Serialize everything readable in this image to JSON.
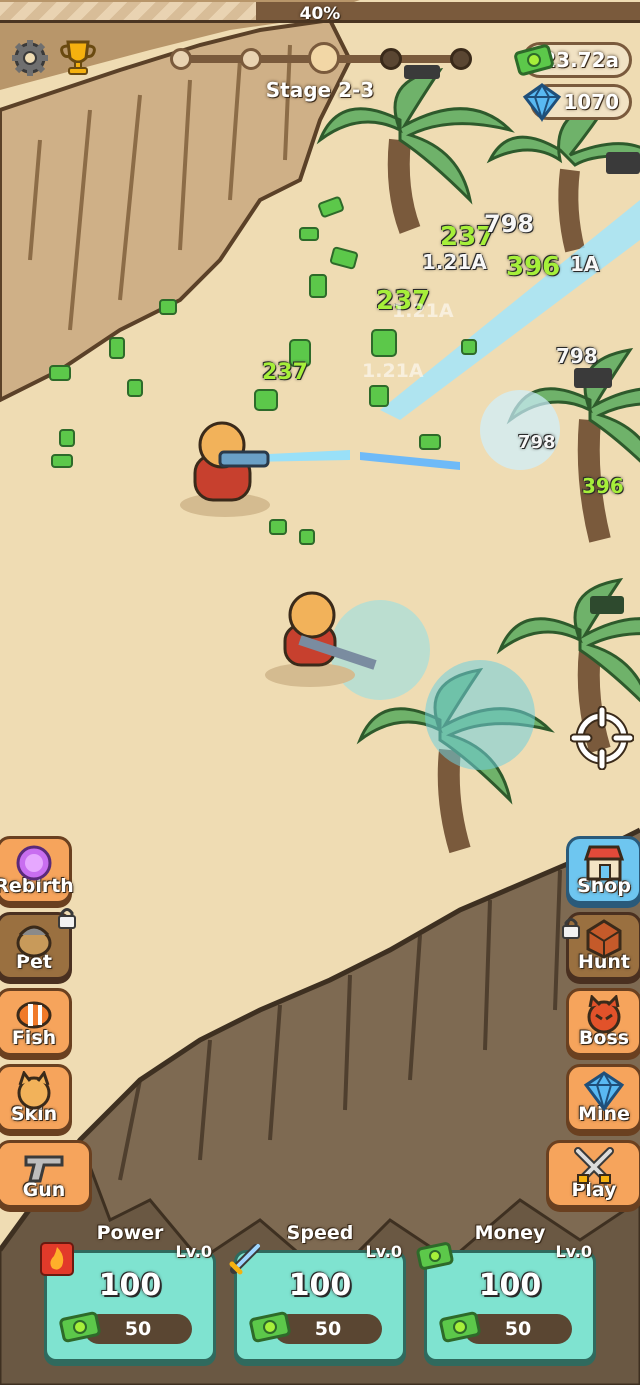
{
  "progress": {
    "percent": 0.4,
    "label": "40%"
  },
  "header": {
    "settings_icon": "gear-icon",
    "trophy_icon": "trophy-icon",
    "stage_label": "Stage 2-3",
    "stage_progress": {
      "completed_steps": 2,
      "current_step": 3,
      "total_steps": 5
    }
  },
  "currency": {
    "money": "23.72a",
    "gems": "1070"
  },
  "left_menu": [
    {
      "label": "Rebirth",
      "icon": "rebirth-orb-icon",
      "locked": false
    },
    {
      "label": "Pet",
      "icon": "pet-icon",
      "locked": true
    },
    {
      "label": "Fish",
      "icon": "clownfish-icon",
      "locked": false
    },
    {
      "label": "Skin",
      "icon": "cat-skin-icon",
      "locked": false
    },
    {
      "label": "Gun",
      "icon": "pistol-icon",
      "locked": false
    }
  ],
  "right_menu": [
    {
      "label": "Shop",
      "icon": "shop-icon",
      "locked": false
    },
    {
      "label": "Hunt",
      "icon": "hunt-crate-icon",
      "locked": true
    },
    {
      "label": "Boss",
      "icon": "boss-icon",
      "locked": false
    },
    {
      "label": "Mine",
      "icon": "gem-icon",
      "locked": false
    },
    {
      "label": "Play",
      "icon": "crossed-swords-icon",
      "locked": false
    }
  ],
  "upgrades": [
    {
      "title": "Power",
      "level": "Lv.0",
      "value": "100",
      "cost": "50",
      "icon": "fire-icon"
    },
    {
      "title": "Speed",
      "level": "Lv.0",
      "value": "100",
      "cost": "50",
      "icon": "sword-icon"
    },
    {
      "title": "Money",
      "level": "Lv.0",
      "value": "100",
      "cost": "50",
      "icon": "cash-icon"
    }
  ],
  "floating_numbers": [
    {
      "text": "237",
      "style": "green"
    },
    {
      "text": "396",
      "style": "green"
    },
    {
      "text": "237",
      "style": "green"
    },
    {
      "text": "237",
      "style": "green"
    },
    {
      "text": "396",
      "style": "green"
    },
    {
      "text": "798",
      "style": "white"
    },
    {
      "text": "798",
      "style": "white"
    },
    {
      "text": "798",
      "style": "white"
    },
    {
      "text": "1.21A",
      "style": "faint"
    },
    {
      "text": "1.21A",
      "style": "faint"
    },
    {
      "text": "1.21A",
      "style": "white"
    },
    {
      "text": "1A",
      "style": "white"
    }
  ],
  "colors": {
    "sand": "#efdcb3",
    "cliff": "#c9ab80",
    "upgrade_card": "#7fe3d0",
    "damage_green": "#a6ef3a",
    "button_orange": "#f6a45c",
    "button_blue": "#6ec6f0"
  }
}
